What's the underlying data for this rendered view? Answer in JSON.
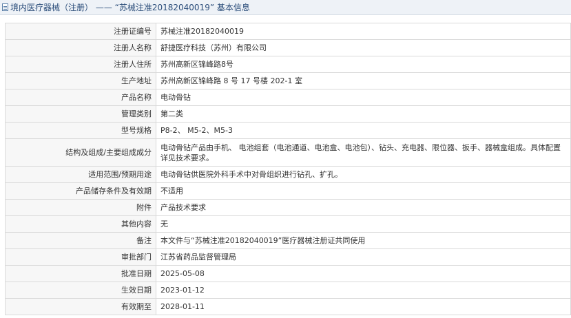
{
  "header": {
    "title": "境内医疗器械（注册） ——  “苏械注准20182040019”  基本信息"
  },
  "rows": [
    {
      "label": "注册证编号",
      "value": "苏械注准20182040019"
    },
    {
      "label": "注册人名称",
      "value": "舒捷医疗科技（苏州）有限公司"
    },
    {
      "label": "注册人住所",
      "value": "苏州高新区锦峰路8号"
    },
    {
      "label": "生产地址",
      "value": "苏州高新区锦峰路 8 号 17 号楼 202-1 室"
    },
    {
      "label": "产品名称",
      "value": "电动骨钻"
    },
    {
      "label": "管理类别",
      "value": "第二类"
    },
    {
      "label": "型号规格",
      "value": "P8-2、 M5-2、M5-3"
    },
    {
      "label": "结构及组成/主要组成成分",
      "value": "电动骨钻产品由手机、 电池组套（电池通道、电池盒、电池包）、钻头、充电器、限位器、扳手、器械盒组成。具体配置详见技术要求。"
    },
    {
      "label": "适用范围/预期用途",
      "value": "电动骨钻供医院外科手术中对骨组织进行钻孔、扩孔。"
    },
    {
      "label": "产品储存条件及有效期",
      "value": "不适用"
    },
    {
      "label": "附件",
      "value": "产品技术要求"
    },
    {
      "label": "其他内容",
      "value": "无"
    },
    {
      "label": "备注",
      "value": "本文件与“苏械注准20182040019”医疗器械注册证共同使用"
    },
    {
      "label": "审批部门",
      "value": "江苏省药品监督管理局"
    },
    {
      "label": "批准日期",
      "value": "2025-05-08"
    },
    {
      "label": "生效日期",
      "value": "2023-01-12"
    },
    {
      "label": "有效期至",
      "value": "2028-01-11"
    }
  ]
}
